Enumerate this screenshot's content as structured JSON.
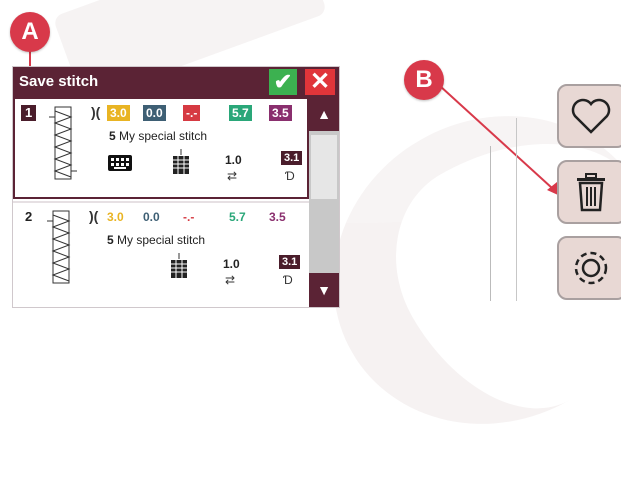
{
  "callouts": {
    "a": "A",
    "b": "B"
  },
  "dialog": {
    "title": "Save stitch",
    "ok_icon": "check-icon",
    "cancel_icon": "close-icon"
  },
  "stitches": [
    {
      "number": "1",
      "values": [
        "3.0",
        "0.0",
        "-.-",
        "5.7",
        "3.5"
      ],
      "name_number": "5",
      "name_text": " My special stitch",
      "tension": "1.0",
      "presser": "3.1"
    },
    {
      "number": "2",
      "values": [
        "3.0",
        "0.0",
        "-.-",
        "5.7",
        "3.5"
      ],
      "name_number": "5",
      "name_text": " My special stitch",
      "tension": "1.0",
      "presser": "3.1"
    }
  ],
  "side_panel": [
    "heart-icon",
    "trash-icon",
    "gear-icon"
  ],
  "colors": {
    "titlebar": "#5b2335",
    "ok": "#3cb150",
    "cancel": "#e0353a",
    "callout": "#d8394a",
    "value_yellow": "#e9b423",
    "value_blue": "#3e5f74",
    "value_red": "#d63a42",
    "value_green": "#2aa779",
    "value_purple": "#8a2f6e"
  }
}
